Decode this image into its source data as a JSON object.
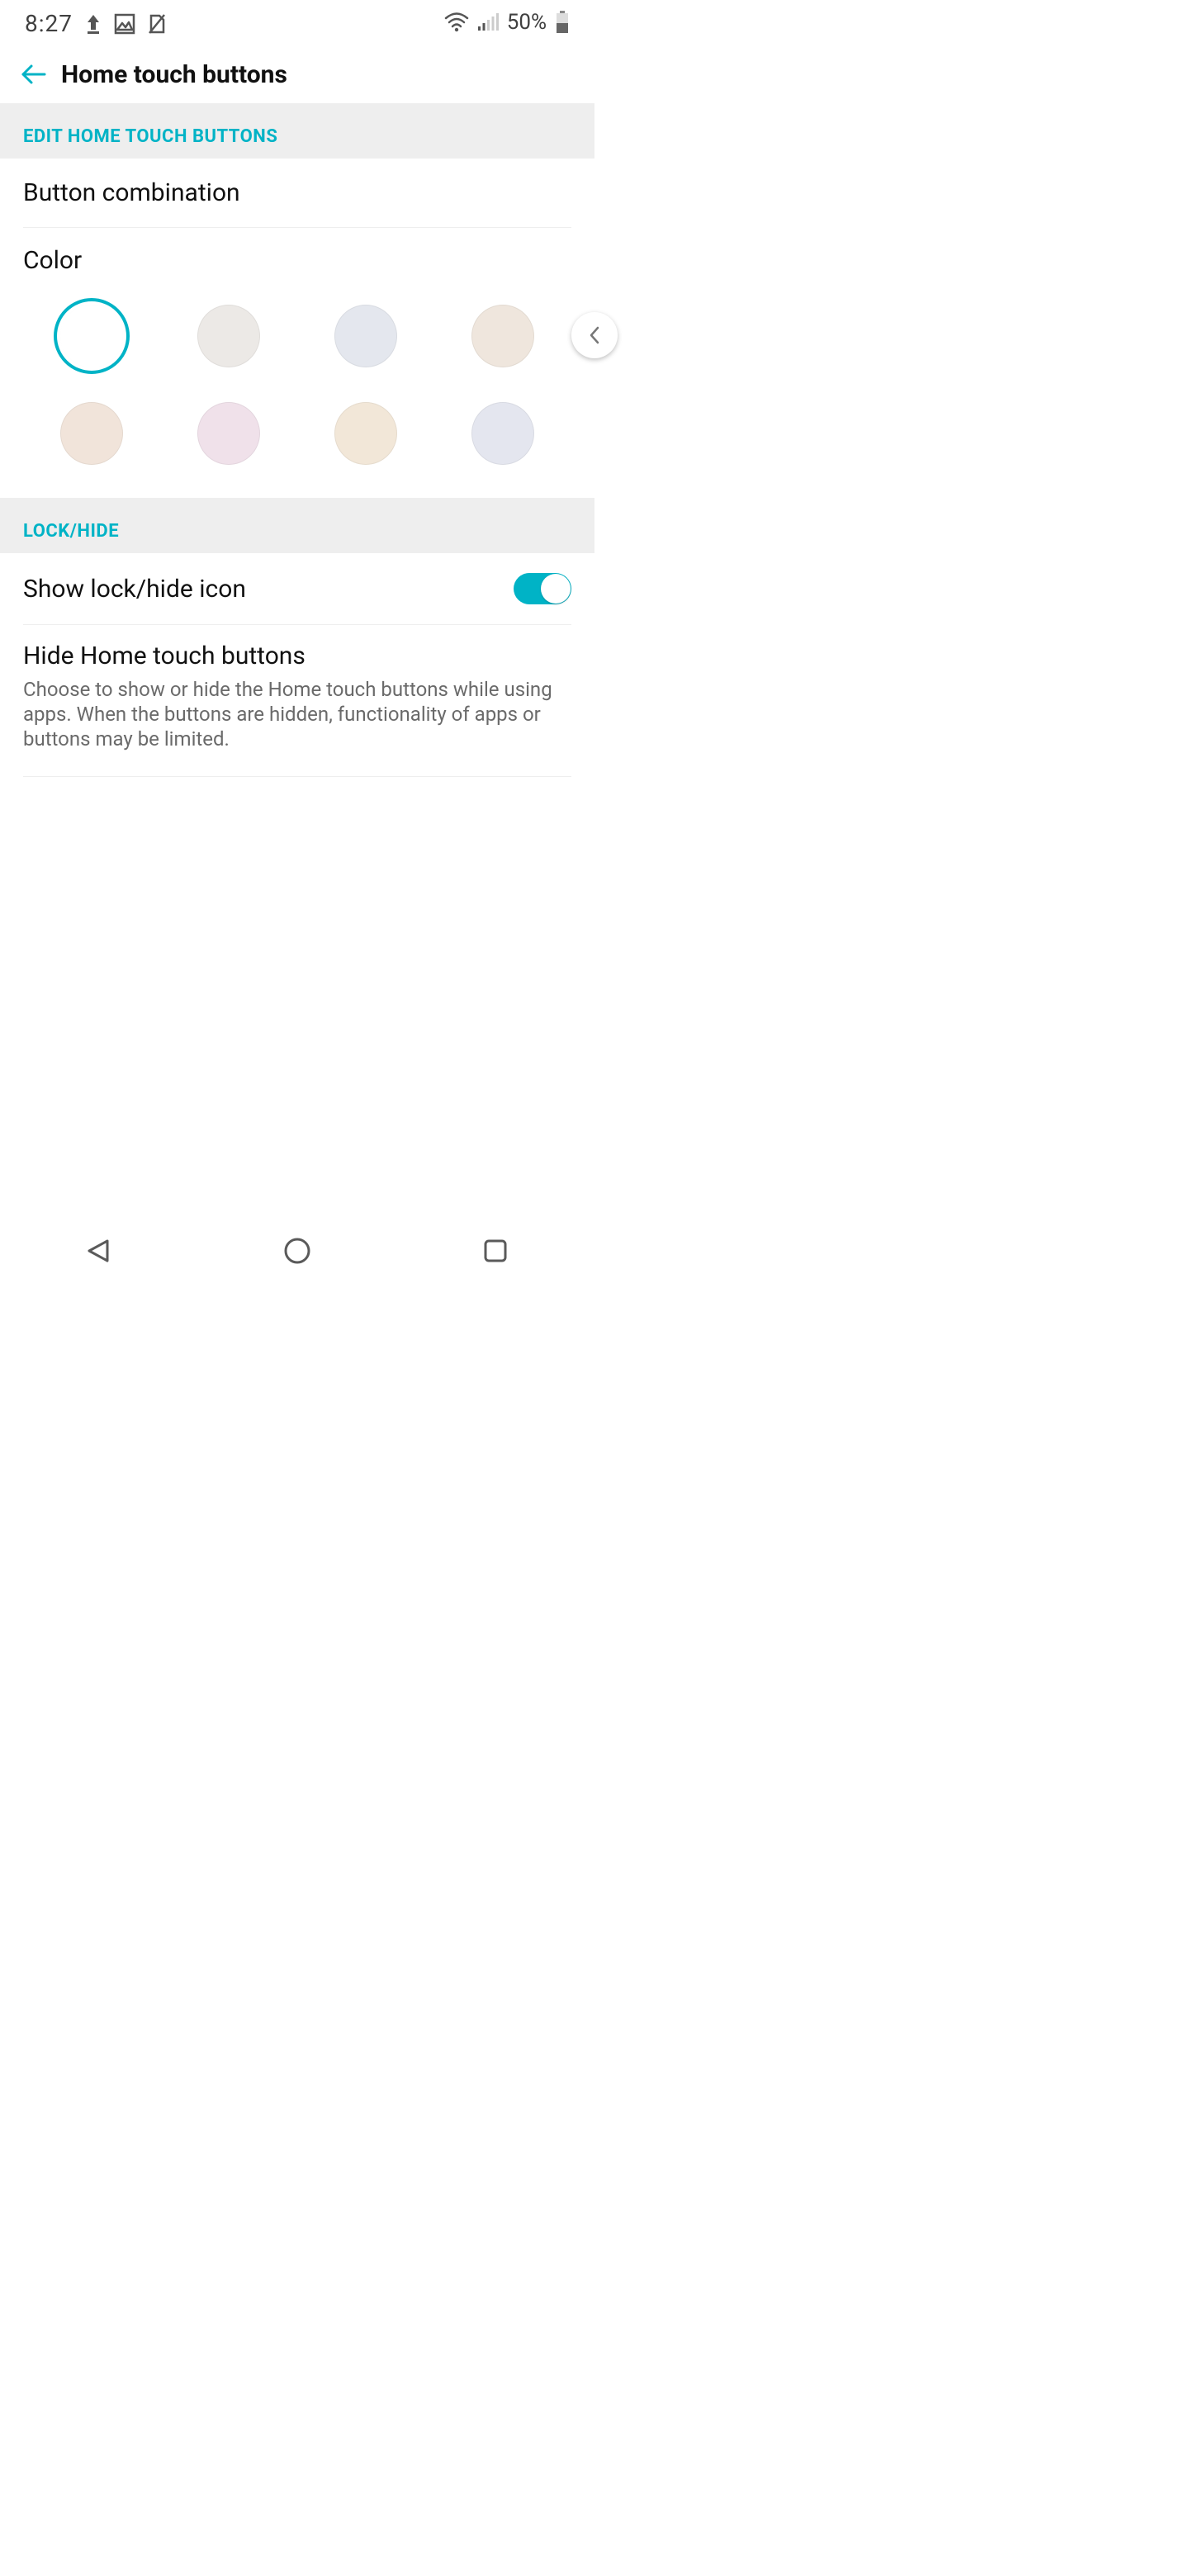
{
  "status": {
    "time": "8:27",
    "battery_pct": "50%"
  },
  "appbar": {
    "title": "Home touch buttons"
  },
  "section1": {
    "header": "EDIT HOME TOUCH BUTTONS",
    "button_combination_label": "Button combination",
    "color_label": "Color"
  },
  "colors": [
    {
      "hex": "#ffffff",
      "selected": true
    },
    {
      "hex": "#ece9e6",
      "selected": false
    },
    {
      "hex": "#e4e7ee",
      "selected": false
    },
    {
      "hex": "#efe6dd",
      "selected": false
    },
    {
      "hex": "#f1e4da",
      "selected": false
    },
    {
      "hex": "#f0e1ea",
      "selected": false
    },
    {
      "hex": "#f2e7d8",
      "selected": false
    },
    {
      "hex": "#e4e6ef",
      "selected": false
    }
  ],
  "section2": {
    "header": "LOCK/HIDE",
    "show_lock_hide_label": "Show lock/hide icon",
    "show_lock_hide_on": true,
    "hide_title": "Hide Home touch buttons",
    "hide_desc": "Choose to show or hide the Home touch buttons while using apps. When the buttons are hidden, functionality of apps or buttons may be limited."
  }
}
